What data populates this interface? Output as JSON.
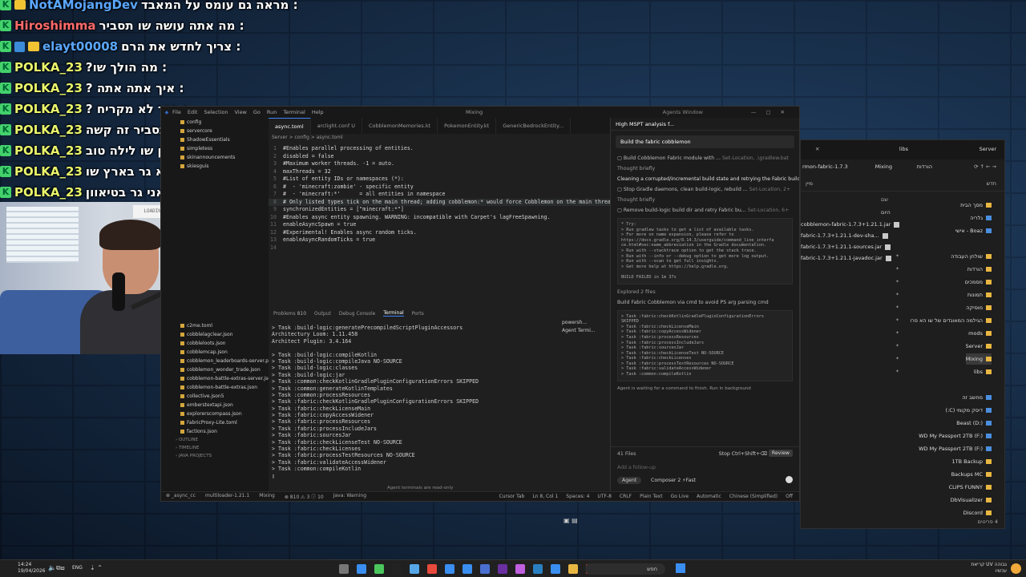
{
  "chat": [
    {
      "user": "NotAMojangDev",
      "msg": ": מראה גם עומס על המאבד",
      "color": "blue",
      "badges": [
        "k",
        "crown"
      ]
    },
    {
      "user": "Hiroshimma",
      "msg": ": מה אתה עושה שו תסביר",
      "color": "red",
      "badges": [
        "k"
      ]
    },
    {
      "user": "elayt00008",
      "msg": ": צריך לחדש את הרם",
      "color": "blue",
      "badges": [
        "k",
        "blue",
        "crown"
      ]
    },
    {
      "user": "POLKA_23",
      "msg": ": מה הולך שו?",
      "color": "yellow",
      "badges": [
        "k"
      ]
    },
    {
      "user": "POLKA_23",
      "msg": ": איך אתה אתה ?",
      "color": "yellow",
      "badges": [
        "k"
      ]
    },
    {
      "user": "POLKA_23",
      "msg": ": כבר לא מקריח ?",
      "color": "yellow",
      "badges": [
        "k"
      ]
    },
    {
      "user": "POLKA_23",
      "msg": ": אז אל תסביר זה קשה",
      "color": "yellow",
      "badges": [
        "k"
      ]
    },
    {
      "user": "POLKA_23",
      "msg": ": טוב אני הלכתי לישון שו לילה טוב",
      "color": "yellow",
      "badges": [
        "k"
      ]
    },
    {
      "user": "POLKA_23",
      "msg": ": אני לא גר בארץ שו",
      "color": "yellow",
      "badges": [
        "k"
      ]
    },
    {
      "user": "POLKA_23",
      "msg": ": אני גר בטיאוון",
      "color": "yellow",
      "badges": [
        "k"
      ]
    }
  ],
  "webcam": {
    "device_label": "LOADING"
  },
  "vscode": {
    "menu": [
      "File",
      "Edit",
      "Selection",
      "View",
      "Go",
      "Run",
      "Terminal",
      "Help"
    ],
    "window_title": "Mixing",
    "agent_window": "Agents Window",
    "explorer_top": [
      "config",
      "servercore",
      "ShadowEssentials",
      "simpletess",
      "skinannouncements",
      "skiesguis"
    ],
    "explorer_files": [
      "c2me.toml",
      "cobblelagclear.json",
      "cobbleloots.json",
      "cobblemcap.json",
      "cobblemon_leaderboards-server.pr...",
      "cobblemon_wonder_trade.json",
      "cobblemon-battle-extras-server.json",
      "cobblemon-battle-extras.json",
      "collective.json5",
      "emberstextapi.json",
      "explorerscompass.json",
      "FabricProxy-Lite.toml",
      "factions.json"
    ],
    "explorer_sections": [
      "OUTLINE",
      "TIMELINE",
      "JAVA PROJECTS"
    ],
    "tabs": [
      {
        "label": "async.toml",
        "active": true
      },
      {
        "label": "arclight.conf U",
        "active": false
      },
      {
        "label": "CobblemonMemories.kt",
        "active": false
      },
      {
        "label": "PokemonEntity.kt",
        "active": false
      },
      {
        "label": "GenericBedrockEntity...",
        "active": false
      }
    ],
    "breadcrumb": "Server > config > async.toml",
    "code_lines": [
      "#Enables parallel processing of entities.",
      "disabled = false",
      "#Maximum worker threads. -1 = auto.",
      "maxThreads = 32",
      "#List of entity IDs or namespaces (*):",
      "#  - 'minecraft:zombie' - specific entity",
      "#  - 'minecraft:*'      = all entities in namespace",
      "# Only listed types tick on the main thread; adding cobblemon:* would force Cobblemon on the main threa",
      "synchronizedEntities = [\"minecraft:*\"]",
      "#Enables async entity spawning. WARNING: incompatible with Carpet's lagFreeSpawning.",
      "enableAsyncSpawn = true",
      "#Experimental! Enables async random ticks.",
      "enableAsyncRandomTicks = true",
      ""
    ],
    "panel_tabs": [
      "Problems",
      "Output",
      "Debug Console",
      "Terminal",
      "Ports"
    ],
    "problems_count": "810",
    "terminal_lines": [
      "> Task :build-logic:generatePrecompiledScriptPluginAccessors",
      "Architectury Loom: 1.11.458",
      "Architect Plugin: 3.4.164",
      "",
      "> Task :build-logic:compileKotlin",
      "> Task :build-logic:compileJava NO-SOURCE",
      "> Task :build-logic:classes",
      "> Task :build-logic:jar",
      "> Task :common:checkKotlinGradlePluginConfigurationErrors SKIPPED",
      "> Task :common:generateKotlinTemplates",
      "> Task :common:processResources",
      "> Task :fabric:checkKotlinGradlePluginConfigurationErrors SKIPPED",
      "> Task :fabric:checkLicenseMain",
      "> Task :fabric:copyAccessWidener",
      "> Task :fabric:processResources",
      "> Task :fabric:processIncludeJars",
      "> Task :fabric:sourcesJar",
      "> Task :fabric:checkLicenseTest NO-SOURCE",
      "> Task :fabric:checkLicenses",
      "> Task :fabric:processTestResources NO-SOURCE",
      "> Task :fabric:validateAccessWidener",
      "> Task :common:compileKotlin",
      "▯"
    ],
    "terminal_side": [
      "powersh...",
      "Agent Termi..."
    ],
    "terminal_note": "Agent terminals are read-only",
    "status_left": [
      "⊗ _async_cc",
      "multiloader-1.21.1",
      "Mixing",
      "⊗ 810 ⚠ 3 ⓘ 10",
      "Java: Warning"
    ],
    "status_right": [
      "Cursor Tab",
      "Ln 8, Col 1",
      "Spaces: 4",
      "UTF-8",
      "CRLF",
      "Plain Text",
      "Go Live",
      "Automatic",
      "Chinese (Simplified)",
      "Off"
    ]
  },
  "agent": {
    "title": "High MSPT analysis f...",
    "prompt": "Build the fabric cobblemon",
    "items": [
      {
        "type": "item",
        "text": "Build Cobblemon Fabric module with ...",
        "dim": "Set-Location, .\\gradlew.bat"
      },
      {
        "type": "thought",
        "text": "Thought briefly"
      },
      {
        "type": "plain",
        "text": "Cleaning a corrupted/incremental build state and retrying the Fabric build."
      },
      {
        "type": "item",
        "text": "Stop Gradle daemons, clean build-logic, rebuild ...",
        "dim": "Set-Location, 2+"
      },
      {
        "type": "thought",
        "text": "Thought briefly"
      },
      {
        "type": "item",
        "text": "Remove build-logic build dir and retry Fabric bu...",
        "dim": "Set-Location, 6+"
      }
    ],
    "codebox1": [
      "* Try:",
      "> Run gradlew tasks to get a list of available tasks.",
      "> For more on name expansion, please refer to",
      "https://docs.gradle.org/8.14.3/userguide/command_line_interfa",
      "ce.html#sec:name_abbreviation in the Gradle documentation.",
      "> Run with --stacktrace option to get the stack trace.",
      "> Run with --info or --debug option to get more log output.",
      "> Run with --scan to get full insights.",
      "> Get more help at https://help.gradle.org.",
      "",
      "BUILD FAILED in 1m 37s"
    ],
    "explored": "Explored 2 files",
    "item2": {
      "text": "Build Fabric Cobblemon via cmd to avoid PS arg parsing cmd"
    },
    "codebox2": [
      "> Task :fabric:checkKotlinGradlePluginConfigurationErrors",
      "SKIPPED",
      "> Task :fabric:checkLicenseMain",
      "> Task :fabric:copyAccessWidener",
      "> Task :fabric:processResources",
      "> Task :fabric:processIncludeJars",
      "> Task :fabric:sourcesJar",
      "> Task :fabric:checkLicenseTest NO-SOURCE",
      "> Task :fabric:checkLicenses",
      "> Task :fabric:processTestResources NO-SOURCE",
      "> Task :fabric:validateAccessWidener",
      "> Task :common:compileKotlin"
    ],
    "waiting": "Agent is waiting for a command to finish. Run in background",
    "files": "41 Files",
    "stop": "Stop Ctrl+Shift+⌫",
    "review": "Review",
    "follow_placeholder": "Add a follow-up",
    "mode": "Agent",
    "model": "Composer 2 ⚡Fast"
  },
  "file_explorer": {
    "tabs": [
      "Server",
      "libs"
    ],
    "address": [
      "Mixing",
      "הורדות",
      "rmon-fabric-1.7.3"
    ],
    "toolbar": [
      "חדש",
      "מיין",
      "הצג"
    ],
    "col_header": "שם",
    "group_header": "היום",
    "nav": [
      {
        "label": "מסך הבית",
        "icon": "home"
      },
      {
        "label": "גלריה",
        "icon": "gallery"
      },
      {
        "label": "Boaz - אישי",
        "icon": "cloud"
      },
      {
        "label": "שולחן העבודה",
        "icon": "folder"
      },
      {
        "label": "הורדות",
        "icon": "folder"
      },
      {
        "label": "מסמכים",
        "icon": "folder"
      },
      {
        "label": "תמונות",
        "icon": "folder"
      },
      {
        "label": "מוסיקה",
        "icon": "folder"
      },
      {
        "label": "הגילמה המאוגדים של שו הא פרו",
        "icon": "folder"
      },
      {
        "label": "mods",
        "icon": "folder"
      },
      {
        "label": "Server",
        "icon": "folder"
      },
      {
        "label": "Mixing",
        "icon": "folder"
      },
      {
        "label": "libs",
        "icon": "folder"
      },
      {
        "label": "מחשב זה",
        "icon": "pc"
      },
      {
        "label": "דיסק מקומי (C:)",
        "icon": "drive"
      },
      {
        "label": "Beast (D:)",
        "icon": "drive"
      },
      {
        "label": "WD My Passport 2TB (F:)",
        "icon": "drive"
      },
      {
        "label": "WD My Passport 2TB (F:)",
        "icon": "drive"
      },
      {
        "label": "1TB Backup",
        "icon": "folder"
      },
      {
        "label": "Backups MC",
        "icon": "folder"
      },
      {
        "label": "CLIPS FUNNY",
        "icon": "folder"
      },
      {
        "label": "DbVisualizer",
        "icon": "folder"
      },
      {
        "label": "Discord",
        "icon": "folder"
      }
    ],
    "files": [
      "cobblemon-fabric-1.7.3+1.21.1.jar",
      "fabric-1.7.3+1.21.1-dev-sha...",
      "fabric-1.7.3+1.21.1-sources.jar",
      "fabric-1.7.3+1.21.1-javadoc.jar"
    ],
    "item_count": "4 פריטים"
  },
  "taskbar": {
    "time": "14:24",
    "date": "19/04/2026",
    "lang": "ENG",
    "search": "חפש",
    "weather_line1": "קריאת UV גבוהה",
    "weather_line2": "עכשיו"
  },
  "colors": {
    "accent": "#3b82f6",
    "chat_user_yellow": "#e9f56b",
    "chat_user_red": "#ff6a6a",
    "chat_user_blue": "#5aa7ff",
    "folder": "#e8b642"
  }
}
